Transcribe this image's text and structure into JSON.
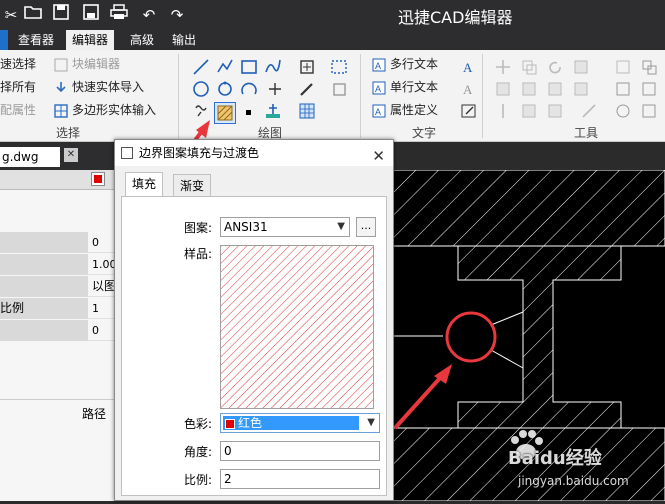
{
  "app": {
    "title": "迅捷CAD编辑器"
  },
  "quick_access": [
    {
      "icon": "cut-icon"
    },
    {
      "icon": "open-folder-icon"
    },
    {
      "icon": "save-icon"
    },
    {
      "icon": "save-as-icon"
    },
    {
      "icon": "print-icon"
    },
    {
      "icon": "undo-icon"
    },
    {
      "icon": "redo-icon"
    }
  ],
  "ribbon_tabs": [
    {
      "label": "查看器"
    },
    {
      "label": "编辑器"
    },
    {
      "label": "高级"
    },
    {
      "label": "输出"
    }
  ],
  "ribbon": {
    "select_group": {
      "label": "选择",
      "items": [
        "速选择",
        "择所有",
        "配属性"
      ],
      "block_editor": "块编辑器",
      "quick_import": "快速实体导入",
      "polygon_import": "多边形实体输入"
    },
    "draw_group": {
      "label": "绘图"
    },
    "text_group": {
      "label": "文字",
      "multiline": "多行文本",
      "singleline": "单行文本",
      "attribute": "属性定义"
    },
    "tools_group": {
      "label": "工具"
    }
  },
  "document_tab": {
    "name": "g.dwg"
  },
  "properties_panel": {
    "rows": [
      {
        "key": "",
        "value": "0"
      },
      {
        "key": "",
        "value": "1.00"
      },
      {
        "key": "",
        "value": "以图"
      },
      {
        "key": "比例",
        "value": "1"
      },
      {
        "key": "",
        "value": "0"
      }
    ],
    "path_label": "路径"
  },
  "dialog": {
    "title": "边界图案填充与过渡色",
    "tabs": [
      {
        "label": "填充"
      },
      {
        "label": "渐变"
      }
    ],
    "pattern_label": "图案:",
    "pattern_value": "ANSI31",
    "browse_label": "...",
    "sample_label": "样品:",
    "color_label": "色彩:",
    "color_value": "红色",
    "angle_label": "角度:",
    "angle_value": "0",
    "scale_label": "比例:",
    "scale_value": "2"
  },
  "colors": {
    "accent_red": "#e00000",
    "dialog_bg": "#f0f0f0",
    "selection_blue": "#3399ff",
    "annotation_red": "#e8383d"
  },
  "watermark": {
    "brand": "Baidu经验",
    "url": "jingyan.baidu.com"
  }
}
